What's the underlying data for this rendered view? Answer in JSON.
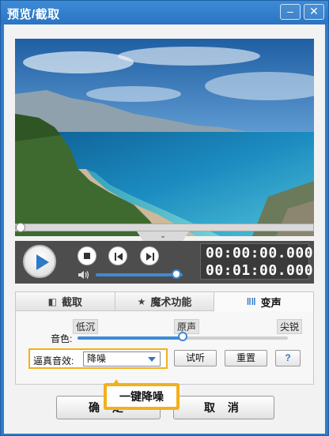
{
  "window": {
    "title": "预览/截取",
    "minimize_icon": "minimize-icon",
    "close_icon": "close-icon"
  },
  "preview": {
    "description_icon": "video-preview-frame",
    "progress_fraction": 0.0
  },
  "playback": {
    "current_time": "00:00:00.000",
    "total_time": "00:01:00.000",
    "volume_fraction": 0.82
  },
  "tabs": [
    {
      "label": "截取",
      "icon": "film-cut-icon",
      "active": false
    },
    {
      "label": "魔术功能",
      "icon": "magic-icon",
      "active": false
    },
    {
      "label": "变声",
      "icon": "waveform-icon",
      "active": true
    }
  ],
  "voice": {
    "tone_label": "音色:",
    "low_label": "低沉",
    "original_label": "原声",
    "sharp_label": "尖锐",
    "tone_fraction": 0.5,
    "effect_label": "逼真音效:",
    "effect_value": "降噪",
    "listen_label": "试听",
    "reset_label": "重置",
    "help_label": "?"
  },
  "footer": {
    "ok_label": "确 定",
    "cancel_label": "取 消"
  },
  "callout": {
    "text": "一键降噪"
  },
  "colors": {
    "accent": "#2e79c6",
    "highlight": "#f3b01a",
    "title_bar": "#2f7bc9"
  }
}
